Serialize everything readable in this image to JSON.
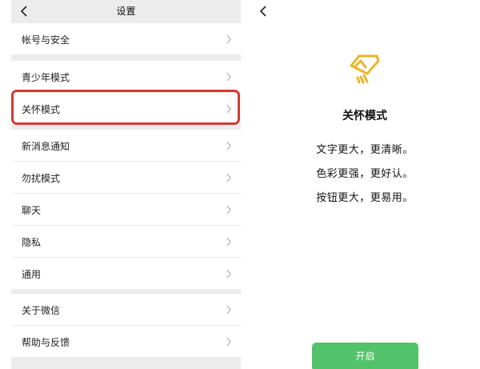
{
  "settings": {
    "title": "设置",
    "items": [
      {
        "label": "帐号与安全"
      },
      {
        "label": "青少年模式"
      },
      {
        "label": "关怀模式"
      },
      {
        "label": "新消息通知"
      },
      {
        "label": "勿扰模式"
      },
      {
        "label": "聊天"
      },
      {
        "label": "隐私"
      },
      {
        "label": "通用"
      },
      {
        "label": "关于微信"
      },
      {
        "label": "帮助与反馈"
      }
    ]
  },
  "care_mode": {
    "title": "关怀模式",
    "features": [
      "文字更大，更清晰。",
      "色彩更强，更好认。",
      "按钮更大，更易用。"
    ],
    "enable_label": "开启",
    "icon": "care-mode-icon"
  },
  "colors": {
    "highlight": "#d63a2e",
    "accent_green": "#52c36a",
    "icon_gold": "#e8b52b",
    "page_bg": "#ececec"
  }
}
